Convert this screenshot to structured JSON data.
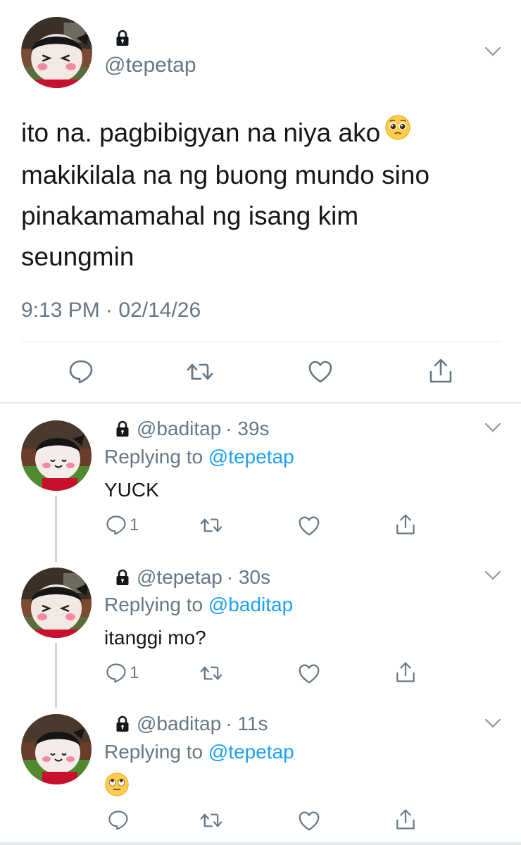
{
  "main_tweet": {
    "handle": "@tepetap",
    "text_lines": [
      "ito na. pagbibigyan na niya ako",
      "makikilala na ng buong mundo sino",
      "pinakamamahal ng isang kim",
      "seungmin"
    ],
    "emoji": "pleading-face",
    "timestamp": "9:13 PM · 02/14/26",
    "actions": [
      "reply-icon",
      "retweet-icon",
      "like-icon",
      "share-icon"
    ]
  },
  "replies": [
    {
      "handle": "@baditap",
      "time": "· 39s",
      "replying_prefix": "Replying to ",
      "replying_to": "@tepetap",
      "text": "YUCK",
      "reply_count": "1"
    },
    {
      "handle": "@tepetap",
      "time": "· 30s",
      "replying_prefix": "Replying to ",
      "replying_to": "@baditap",
      "text": "itanggi mo?",
      "reply_count": "1"
    },
    {
      "handle": "@baditap",
      "time": "· 11s",
      "replying_prefix": "Replying to ",
      "replying_to": "@tepetap",
      "text": "",
      "emoji": "face-with-rolling-eyes",
      "reply_count": ""
    }
  ],
  "colors": {
    "text": "#14171a",
    "secondary": "#657786",
    "accent": "#1da1f2",
    "divider": "#e1e8ed"
  }
}
